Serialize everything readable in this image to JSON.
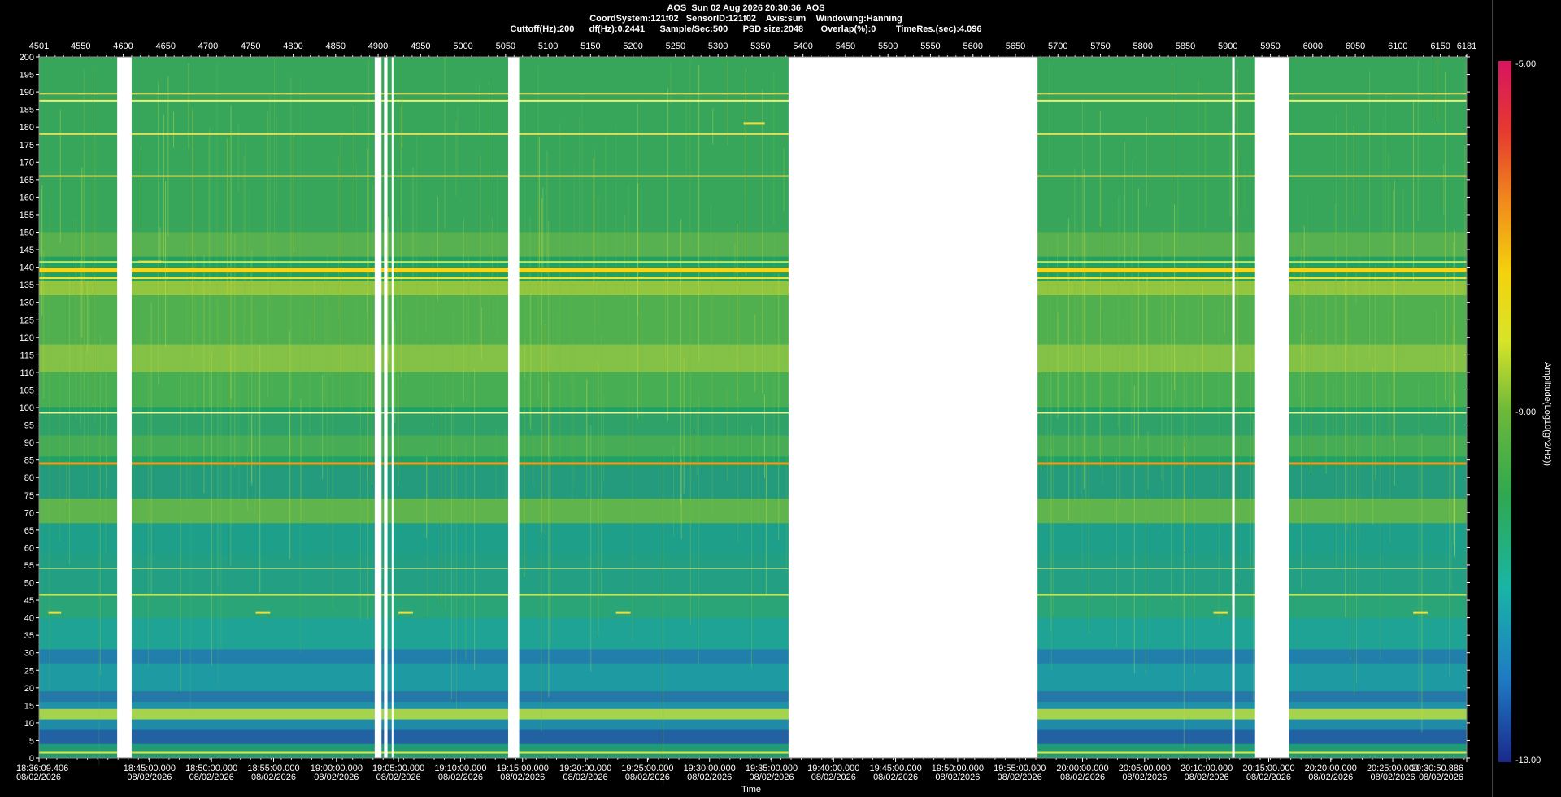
{
  "header": {
    "line1": "AOS  Sun 02 Aug 2026 20:30:36  AOS",
    "line2": "CoordSystem:121f02   SensorID:121f02    Axis:sum    Windowing:Hanning",
    "line3": "Cuttoff(Hz):200      df(Hz):0.2441      Sample/Sec:500      PSD size:2048       Overlap(%):0        TimeRes.(sec):4.096"
  },
  "chart_data": {
    "type": "heatmap",
    "title": "AOS  Sun 02 Aug 2026 20:30:36  AOS",
    "xlabel": "Time",
    "ylabel": "",
    "colorbar_label": "Amplitude(Log10(g^2/Hz))",
    "colorbar_ticks": [
      "-5.00",
      "-9.00",
      "-13.00"
    ],
    "colorbar_range": [
      -13,
      -5
    ],
    "colors": [
      "#1a2a8c",
      "#1e7bc4",
      "#19b5a6",
      "#2fa84f",
      "#6cb83a",
      "#d7e428",
      "#f5d10c",
      "#f08a1c",
      "#e63a2e",
      "#d81460"
    ],
    "background_color": "#1fa267",
    "ylim": [
      0,
      200
    ],
    "y_ticks": [
      0,
      5,
      10,
      15,
      20,
      25,
      30,
      35,
      40,
      45,
      50,
      55,
      60,
      65,
      70,
      75,
      80,
      85,
      90,
      95,
      100,
      105,
      110,
      115,
      120,
      125,
      130,
      135,
      140,
      145,
      150,
      155,
      160,
      165,
      170,
      175,
      180,
      185,
      190,
      195,
      200
    ],
    "xlim_index": [
      4501,
      6181
    ],
    "top_ticks": [
      {
        "label": "4501",
        "value": 4501
      },
      {
        "label": "4550",
        "value": 4550
      },
      {
        "label": "4600",
        "value": 4600
      },
      {
        "label": "4650",
        "value": 4650
      },
      {
        "label": "4700",
        "value": 4700
      },
      {
        "label": "4750",
        "value": 4750
      },
      {
        "label": "4800",
        "value": 4800
      },
      {
        "label": "4850",
        "value": 4850
      },
      {
        "label": "4900",
        "value": 4900
      },
      {
        "label": "4950",
        "value": 4950
      },
      {
        "label": "5000",
        "value": 5000
      },
      {
        "label": "5050",
        "value": 5050
      },
      {
        "label": "5100",
        "value": 5100
      },
      {
        "label": "5150",
        "value": 5150
      },
      {
        "label": "5200",
        "value": 5200
      },
      {
        "label": "5250",
        "value": 5250
      },
      {
        "label": "5300",
        "value": 5300
      },
      {
        "label": "5350",
        "value": 5350
      },
      {
        "label": "5400",
        "value": 5400
      },
      {
        "label": "5450",
        "value": 5450
      },
      {
        "label": "5500",
        "value": 5500
      },
      {
        "label": "5550",
        "value": 5550
      },
      {
        "label": "5600",
        "value": 5600
      },
      {
        "label": "5650",
        "value": 5650
      },
      {
        "label": "5700",
        "value": 5700
      },
      {
        "label": "5750",
        "value": 5750
      },
      {
        "label": "5800",
        "value": 5800
      },
      {
        "label": "5850",
        "value": 5850
      },
      {
        "label": "5900",
        "value": 5900
      },
      {
        "label": "5950",
        "value": 5950
      },
      {
        "label": "6000",
        "value": 6000
      },
      {
        "label": "6050",
        "value": 6050
      },
      {
        "label": "6100",
        "value": 6100
      },
      {
        "label": "6150",
        "value": 6150
      },
      {
        "label": "6181",
        "value": 6181
      }
    ],
    "time_ticks": [
      {
        "label": "18:36:09.406",
        "value": 4501
      },
      {
        "label": "18:45:00.000",
        "value": 4631
      },
      {
        "label": "18:50:00.000",
        "value": 4704
      },
      {
        "label": "18:55:00.000",
        "value": 4777
      },
      {
        "label": "19:00:00.000",
        "value": 4851
      },
      {
        "label": "19:05:00.000",
        "value": 4924
      },
      {
        "label": "19:10:00.000",
        "value": 4997
      },
      {
        "label": "19:15:00.000",
        "value": 5070
      },
      {
        "label": "19:20:00.000",
        "value": 5144
      },
      {
        "label": "19:25:00.000",
        "value": 5217
      },
      {
        "label": "19:30:00.000",
        "value": 5290
      },
      {
        "label": "19:35:00.000",
        "value": 5363
      },
      {
        "label": "19:40:00.000",
        "value": 5436
      },
      {
        "label": "19:45:00.000",
        "value": 5509
      },
      {
        "label": "19:50:00.000",
        "value": 5582
      },
      {
        "label": "19:55:00.000",
        "value": 5655
      },
      {
        "label": "20:00:00.000",
        "value": 5729
      },
      {
        "label": "20:05:00.000",
        "value": 5802
      },
      {
        "label": "20:10:00.000",
        "value": 5875
      },
      {
        "label": "20:15:00.000",
        "value": 5948
      },
      {
        "label": "20:20:00.000",
        "value": 6021
      },
      {
        "label": "20:25:00.000",
        "value": 6094
      },
      {
        "label": "20:30:50.886",
        "value": 6181
      }
    ],
    "date_label": "08/02/2026",
    "gaps_index": [
      [
        4593,
        4610
      ],
      [
        4896,
        4904
      ],
      [
        4907,
        4911
      ],
      [
        4916,
        4918
      ],
      [
        5053,
        5066
      ],
      [
        5383,
        5676
      ],
      [
        5905,
        5908
      ],
      [
        5932,
        5972
      ]
    ],
    "horizontal_lines": [
      {
        "freq": 189.5,
        "color": "#f2ea6a",
        "width": 2
      },
      {
        "freq": 187.5,
        "color": "#f2ea6a",
        "width": 2
      },
      {
        "freq": 178,
        "color": "#e8e05a",
        "width": 2
      },
      {
        "freq": 166,
        "color": "#dfe05a",
        "width": 2
      },
      {
        "freq": 141.5,
        "color": "#cde24a",
        "width": 2
      },
      {
        "freq": 139.2,
        "color": "#f5d51a",
        "width": 6
      },
      {
        "freq": 137,
        "color": "#e9e23a",
        "width": 3
      },
      {
        "freq": 98.5,
        "color": "#f4ef8a",
        "width": 2
      },
      {
        "freq": 84,
        "color": "#ee9a22",
        "width": 3
      },
      {
        "freq": 54,
        "color": "#c9d858",
        "width": 1
      },
      {
        "freq": 46.5,
        "color": "#d6e040",
        "width": 2
      },
      {
        "freq": 1.5,
        "color": "#e6e23a",
        "width": 2
      }
    ],
    "bands": [
      {
        "from": 0,
        "to": 4,
        "color": "#1f9a78"
      },
      {
        "from": 4,
        "to": 8,
        "color": "#235ba8"
      },
      {
        "from": 8,
        "to": 11,
        "color": "#1f88b0"
      },
      {
        "from": 11,
        "to": 14,
        "color": "#b4d84a"
      },
      {
        "from": 14,
        "to": 16,
        "color": "#1f8fb0"
      },
      {
        "from": 16,
        "to": 19,
        "color": "#2672ae"
      },
      {
        "from": 19,
        "to": 27,
        "color": "#1e99a8"
      },
      {
        "from": 27,
        "to": 31,
        "color": "#227bb2"
      },
      {
        "from": 31,
        "to": 40,
        "color": "#1ea39a"
      },
      {
        "from": 40,
        "to": 47,
        "color": "#2aa57a"
      },
      {
        "from": 47,
        "to": 58,
        "color": "#23a086"
      },
      {
        "from": 58,
        "to": 67,
        "color": "#1e9e8e"
      },
      {
        "from": 67,
        "to": 74,
        "color": "#66b64a"
      },
      {
        "from": 74,
        "to": 83,
        "color": "#249a7e"
      },
      {
        "from": 86,
        "to": 92,
        "color": "#4aad54"
      },
      {
        "from": 92,
        "to": 98,
        "color": "#30a268"
      },
      {
        "from": 100,
        "to": 110,
        "color": "#4caf52"
      },
      {
        "from": 110,
        "to": 118,
        "color": "#8ec444"
      },
      {
        "from": 118,
        "to": 132,
        "color": "#55b04c"
      },
      {
        "from": 132,
        "to": 136,
        "color": "#9fc93c"
      },
      {
        "from": 143,
        "to": 150,
        "color": "#5db24e"
      },
      {
        "from": 150,
        "to": 200,
        "color": "#3aa65a"
      }
    ],
    "features": [
      {
        "kind": "dash",
        "freq": 41.5,
        "from_index": 4512,
        "to_index": 4527
      },
      {
        "kind": "dash",
        "freq": 41.5,
        "from_index": 4756,
        "to_index": 4773
      },
      {
        "kind": "dash",
        "freq": 41.5,
        "from_index": 4924,
        "to_index": 4941
      },
      {
        "kind": "dash",
        "freq": 41.5,
        "from_index": 5180,
        "to_index": 5197
      },
      {
        "kind": "dash",
        "freq": 41.5,
        "from_index": 5883,
        "to_index": 5900
      },
      {
        "kind": "dash",
        "freq": 41.5,
        "from_index": 6118,
        "to_index": 6135
      },
      {
        "kind": "dash",
        "freq": 181,
        "from_index": 5330,
        "to_index": 5355
      },
      {
        "kind": "dash",
        "freq": 141.5,
        "from_index": 4618,
        "to_index": 4645
      }
    ]
  }
}
